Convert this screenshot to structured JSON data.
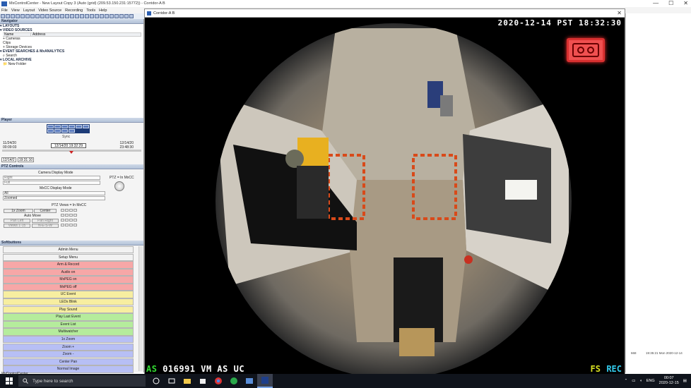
{
  "app": {
    "title": "MxControlCenter - New Layout Copy 3 (Auto (grid) (209.53.150.231:15772)) - Corridor-A B",
    "menu": [
      "File",
      "View",
      "Layout",
      "Video Source",
      "Recording",
      "Tools",
      "Help"
    ],
    "window_controls": [
      "—",
      "☐",
      "✕"
    ]
  },
  "navigator": {
    "title": "Navigator",
    "tree": [
      {
        "label": "▾ LAYOUTS",
        "section": true
      },
      {
        "label": "▾ VIDEO SOURCES",
        "section": true
      },
      {
        "label": "+ Cameras",
        "section": false
      },
      {
        "label": "  Clips",
        "section": false
      },
      {
        "label": "+ Storage Devices",
        "section": false
      },
      {
        "label": "▾ EVENT SEARCHES & MxANALYTICS",
        "section": true
      },
      {
        "label": "  ⌕ Search",
        "section": false
      },
      {
        "label": "▾ LOCAL ARCHIVE",
        "section": true
      },
      {
        "label": "  📁 New Folder",
        "section": false
      }
    ],
    "columns": [
      "Name",
      "Address"
    ]
  },
  "player": {
    "title": "Player",
    "sync_label": "Sync",
    "start_date": "11/24/20",
    "start_time": "00:09:03",
    "current": "12/14/20 19:32:29",
    "end_date": "12/14/20",
    "end_time": "23:48:30",
    "date_input": "12/14/2",
    "time_input": "19:31:10"
  },
  "ptz": {
    "title": "PTZ Controls",
    "camera_display_mode": "Camera Display Mode",
    "cdm_field1": "Right",
    "cdm_field2": "Full",
    "ptz_status": "PTZ = In MxCC",
    "mxcc_display_mode": "MxCC Display Mode",
    "mdm_field1": "All",
    "mdm_field2": "Zoomed",
    "ptz_views": "PTZ Views = In MxCC",
    "btn_zoom": "1x Zoom",
    "btn_center": "Center",
    "auto_move": "Auto Move",
    "btn_pan_left": "Pan Left",
    "btn_pan_right": "Pan Right",
    "btn_views": "Views 1-15",
    "btn_nesw": "N-E-S-W"
  },
  "softbuttons": {
    "title": "Softbuttons",
    "buttons": [
      {
        "label": "Admin Menu",
        "color": "#f2f2f2"
      },
      {
        "label": "Setup Menu",
        "color": "#f2f2f2"
      },
      {
        "label": "Arm & Record",
        "color": "#f7a7a7"
      },
      {
        "label": "Audio on",
        "color": "#f7a7a7"
      },
      {
        "label": "MxPEG on",
        "color": "#f7a7a7"
      },
      {
        "label": "MxPEG off",
        "color": "#f7a7a7"
      },
      {
        "label": "UC Event",
        "color": "#f7eea0"
      },
      {
        "label": "LEDs Blink",
        "color": "#f7eea0"
      },
      {
        "label": "Play Sound",
        "color": "#f7eea0"
      },
      {
        "label": "Play Last Event",
        "color": "#b5ec9c"
      },
      {
        "label": "Event List",
        "color": "#b5ec9c"
      },
      {
        "label": "Multiwatcher",
        "color": "#b5ec9c"
      },
      {
        "label": "1x Zoom",
        "color": "#b7bff5"
      },
      {
        "label": "Zoom +",
        "color": "#b7bff5"
      },
      {
        "label": "Zoom -",
        "color": "#b7bff5"
      },
      {
        "label": "Center Pan",
        "color": "#b7bff5"
      },
      {
        "label": "Normal Image",
        "color": "#b7bff5"
      }
    ]
  },
  "status_bar": {
    "text": "MyControlCenter"
  },
  "video": {
    "window_title": "Corridor-A B",
    "timestamp": "2020-12-14 PST 18:32:30",
    "osd_as": "AS",
    "osd_bottom": "016991 VM AS UC",
    "osd_fs": "FS",
    "osd_rec": "REC"
  },
  "right_panel": {
    "value": "668",
    "timestamp": "19:35:21 Mon 2020-12-14"
  },
  "taskbar": {
    "search_placeholder": "Type here to search",
    "language": "ENG",
    "time": "00:07",
    "date": "2020-12-15"
  }
}
